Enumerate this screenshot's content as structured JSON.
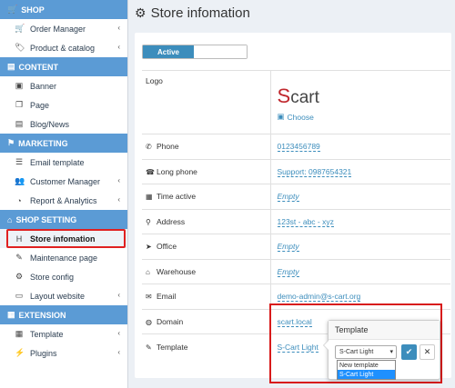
{
  "sidebar": {
    "sections": [
      {
        "title": "SHOP",
        "icon": "cart-icon",
        "items": [
          {
            "label": "Order Manager",
            "icon": "cart-icon",
            "chevron": true
          },
          {
            "label": "Product & catalog",
            "icon": "tags-icon",
            "chevron": true
          }
        ]
      },
      {
        "title": "CONTENT",
        "icon": "file-icon",
        "items": [
          {
            "label": "Banner",
            "icon": "image-icon",
            "chevron": false
          },
          {
            "label": "Page",
            "icon": "copy-icon",
            "chevron": false
          },
          {
            "label": "Blog/News",
            "icon": "file-text-icon",
            "chevron": false
          }
        ]
      },
      {
        "title": "MARKETING",
        "icon": "filter-icon",
        "items": [
          {
            "label": "Email template",
            "icon": "list-icon",
            "chevron": false
          },
          {
            "label": "Customer Manager",
            "icon": "users-icon",
            "chevron": true
          },
          {
            "label": "Report & Analytics",
            "icon": "pie-chart-icon",
            "chevron": true
          }
        ]
      },
      {
        "title": "SHOP SETTING",
        "icon": "store-icon",
        "items": [
          {
            "label": "Store infomation",
            "icon": "h-square-icon",
            "chevron": false,
            "active": true
          },
          {
            "label": "Maintenance page",
            "icon": "wrench-icon",
            "chevron": false
          },
          {
            "label": "Store config",
            "icon": "cog-icon",
            "chevron": false
          },
          {
            "label": "Layout website",
            "icon": "desktop-icon",
            "chevron": true
          }
        ]
      },
      {
        "title": "EXTENSION",
        "icon": "th-icon",
        "items": [
          {
            "label": "Template",
            "icon": "template-icon",
            "chevron": true
          },
          {
            "label": "Plugins",
            "icon": "plug-icon",
            "chevron": true
          }
        ]
      }
    ]
  },
  "main": {
    "title": "Store infomation",
    "toggle_label": "Active",
    "logo_text": "cart",
    "logo_letter": "S",
    "choose_label": "Choose",
    "rows": [
      {
        "key": "Logo",
        "icon": "",
        "value": ""
      },
      {
        "key": "Phone",
        "icon": "phone-icon",
        "value": "0123456789",
        "empty": false
      },
      {
        "key": "Long phone",
        "icon": "phone-square-icon",
        "value": "Support: 0987654321",
        "empty": false
      },
      {
        "key": "Time active",
        "icon": "calendar-icon",
        "value": "Empty",
        "empty": true
      },
      {
        "key": "Address",
        "icon": "map-icon",
        "value": "123st - abc - xyz",
        "empty": false
      },
      {
        "key": "Office",
        "icon": "location-arrow-icon",
        "value": "Empty",
        "empty": true
      },
      {
        "key": "Warehouse",
        "icon": "warehouse-icon",
        "value": "Empty",
        "empty": true
      },
      {
        "key": "Email",
        "icon": "envelope-icon",
        "value": "demo-admin@s-cart.org",
        "empty": false
      },
      {
        "key": "Domain",
        "icon": "globe-icon",
        "value": "scart.local",
        "empty": false
      },
      {
        "key": "Template",
        "icon": "paint-icon",
        "value": "S-Cart Light",
        "empty": false
      }
    ]
  },
  "popover": {
    "title": "Template",
    "selected": "S-Cart Light",
    "options": [
      "New template",
      "S-Cart Light"
    ]
  }
}
